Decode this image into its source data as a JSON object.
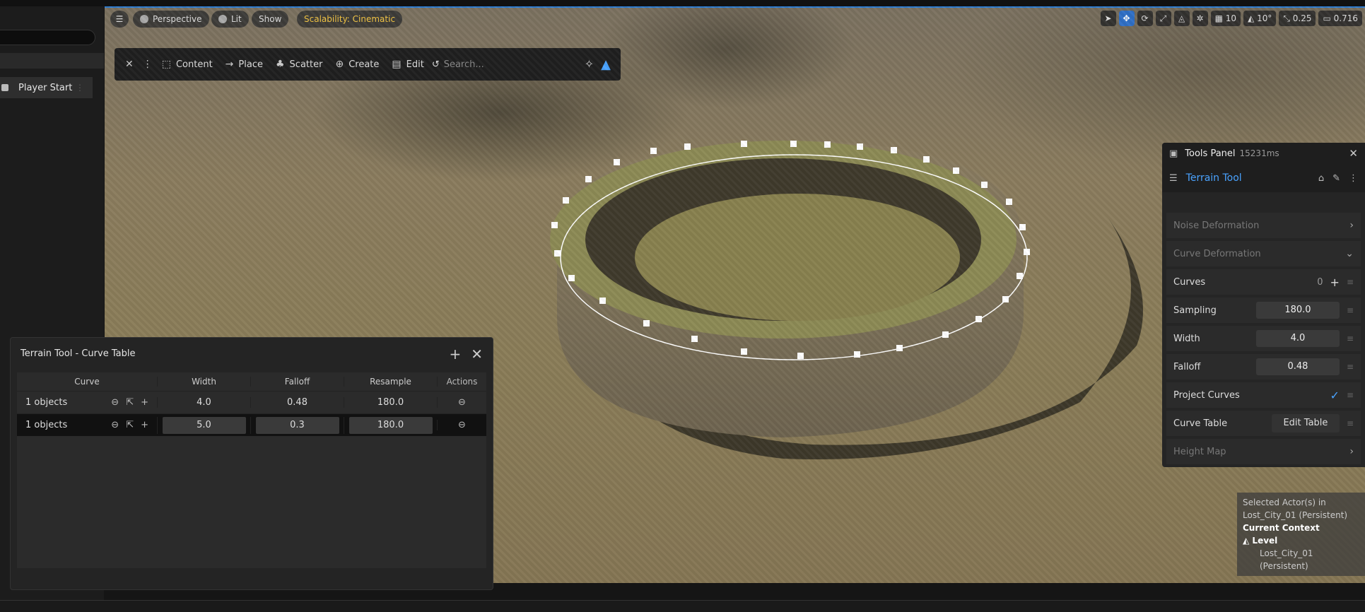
{
  "outliner": {
    "item_player_start": "Player Start"
  },
  "viewport_toolbar": {
    "perspective": "Perspective",
    "lit": "Lit",
    "show": "Show",
    "scalability": "Scalability: Cinematic"
  },
  "transform_toolbar": {
    "grid_snap": "10",
    "rotate_snap": "10°",
    "scale_snap": "0.25",
    "camera_speed": "0.716"
  },
  "mode_bar": {
    "content": "Content",
    "place": "Place",
    "scatter": "Scatter",
    "create": "Create",
    "edit": "Edit",
    "search_placeholder": "Search..."
  },
  "tools_panel": {
    "title": "Tools Panel",
    "timing": "15231ms",
    "tool_name": "Terrain Tool",
    "noise_deformation": "Noise Deformation",
    "curve_deformation": "Curve Deformation",
    "curves_label": "Curves",
    "curves_count": "0",
    "sampling_label": "Sampling",
    "sampling_value": "180.0",
    "width_label": "Width",
    "width_value": "4.0",
    "falloff_label": "Falloff",
    "falloff_value": "0.48",
    "project_curves_label": "Project Curves",
    "curve_table_label": "Curve Table",
    "edit_table_button": "Edit Table",
    "height_map": "Height Map"
  },
  "context": {
    "selected_line1": "Selected Actor(s) in",
    "selected_line2": "Lost_City_01 (Persistent)",
    "current_context": "Current Context",
    "level_label": "Level",
    "level_value": "Lost_City_01 (Persistent)"
  },
  "curve_table": {
    "title": "Terrain Tool - Curve Table",
    "columns": {
      "curve": "Curve",
      "width": "Width",
      "falloff": "Falloff",
      "resample": "Resample",
      "actions": "Actions"
    },
    "rows": [
      {
        "curve": "1 objects",
        "width": "4.0",
        "falloff": "0.48",
        "resample": "180.0"
      },
      {
        "curve": "1 objects",
        "width": "5.0",
        "falloff": "0.3",
        "resample": "180.0"
      }
    ]
  }
}
